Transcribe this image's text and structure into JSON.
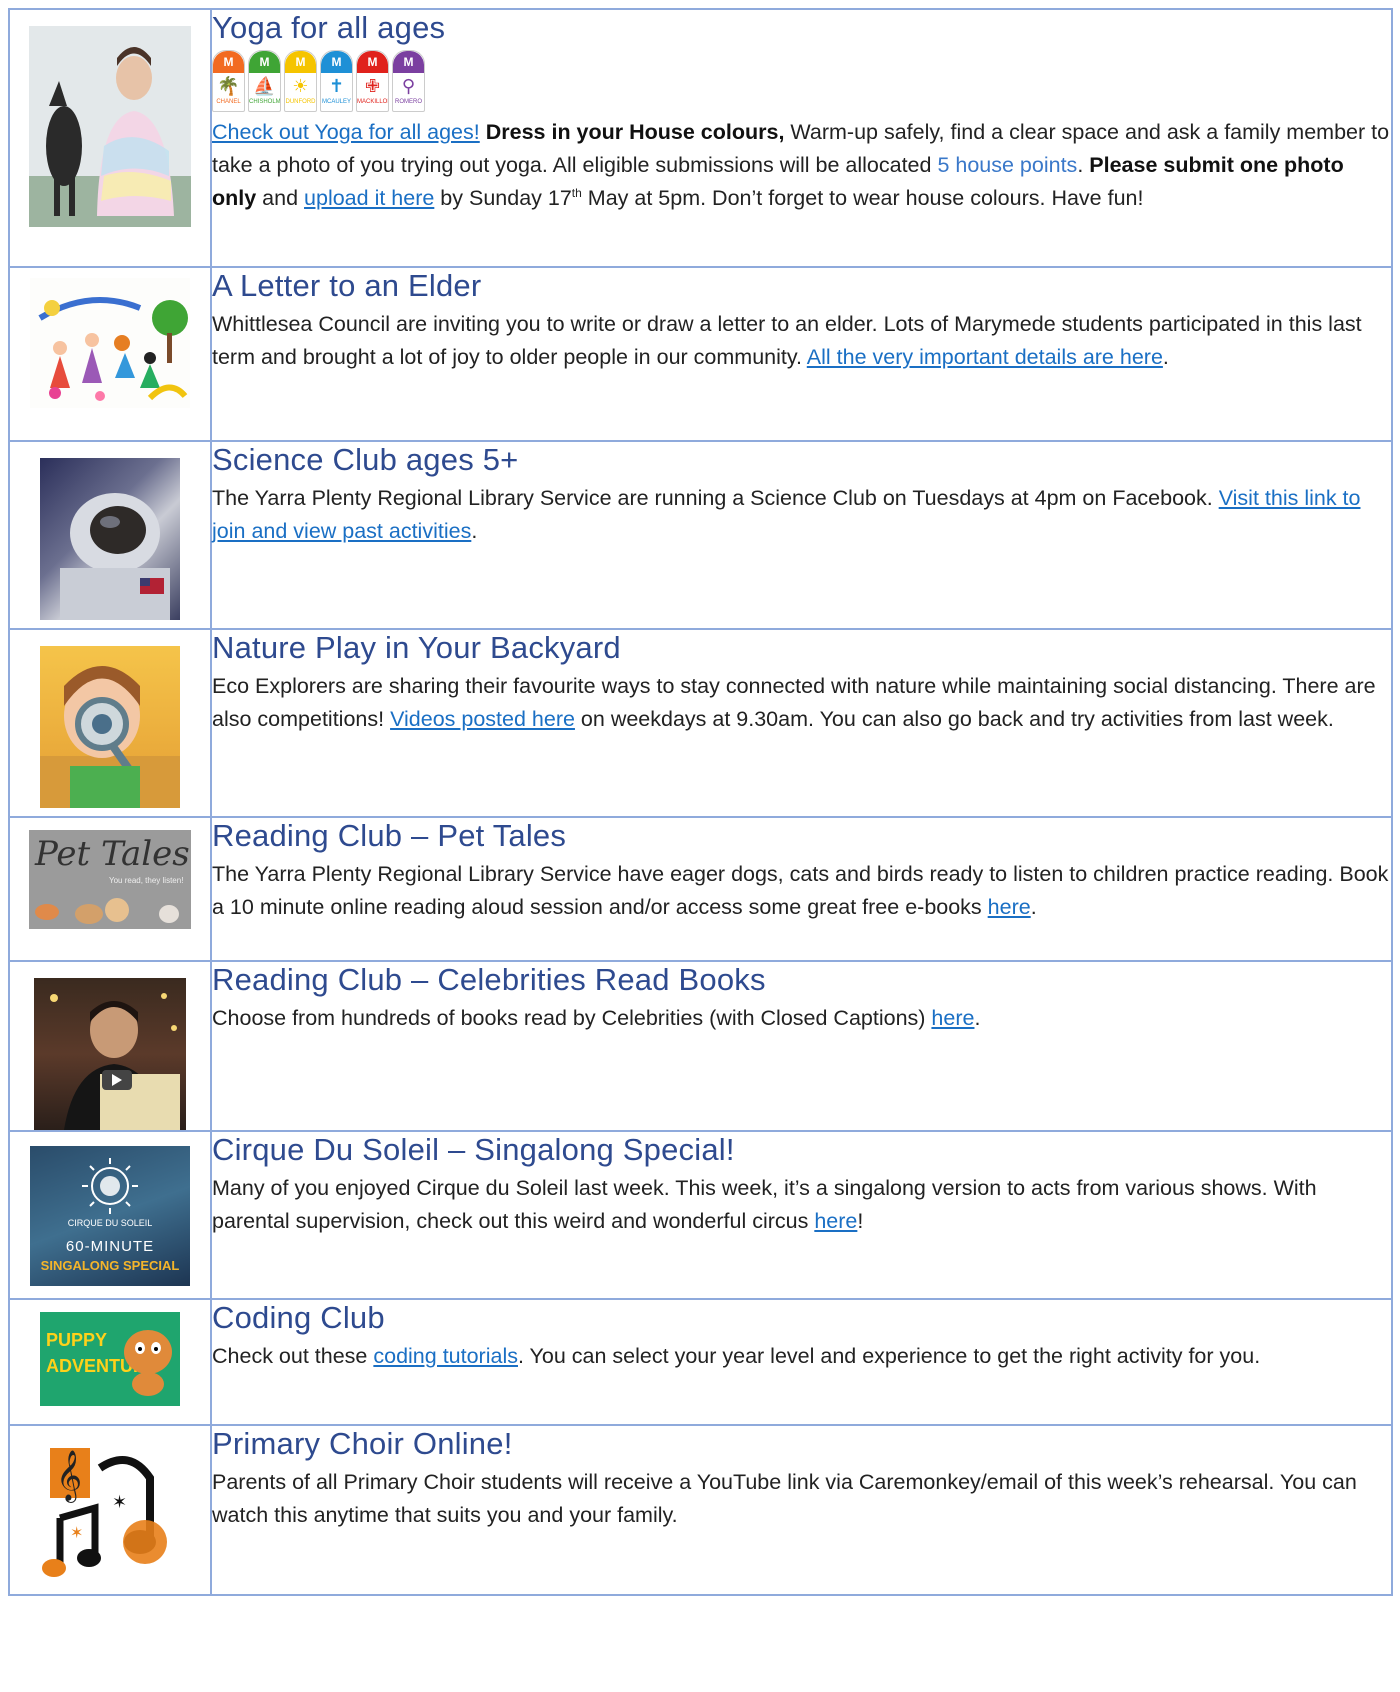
{
  "houses": [
    {
      "initial": "M",
      "color": "#f26a21",
      "symbol": "🌴",
      "name": "CHANEL"
    },
    {
      "initial": "M",
      "color": "#3fa535",
      "symbol": "⛵",
      "name": "CHISHOLM"
    },
    {
      "initial": "M",
      "color": "#f5c400",
      "symbol": "☀",
      "name": "DUNFORD"
    },
    {
      "initial": "M",
      "color": "#1e90d6",
      "symbol": "✝",
      "name": "MCAULEY"
    },
    {
      "initial": "M",
      "color": "#e0221c",
      "symbol": "✙",
      "name": "MACKILLOP"
    },
    {
      "initial": "M",
      "color": "#7b3fa0",
      "symbol": "⚲",
      "name": "ROMERO"
    }
  ],
  "rows": {
    "yoga": {
      "title": "Yoga for all ages",
      "link": "Check out Yoga for all ages!",
      "bold1": "Dress in your House colours,",
      "t1": " Warm-up safely, find a clear space and ask a family member to take a photo of you trying out yoga. All eligible submissions will be allocated ",
      "points": "5 house points",
      "t2": ". ",
      "bold2": "Please submit one photo only",
      "t3": " and ",
      "upload": "upload it here",
      "t4": " by Sunday 17",
      "sup": "th",
      "t5": " May at 5pm. Don’t forget to wear house colours. Have fun!"
    },
    "letter": {
      "title": "A Letter to an Elder",
      "t1": "Whittlesea Council are inviting you to write or draw a letter to an elder. Lots of Marymede students participated in this last term and brought a lot of joy to older people in our community. ",
      "link": "All the very important details are here",
      "t2": "."
    },
    "science": {
      "title": "Science Club ages 5+",
      "t1": "The Yarra Plenty Regional Library Service are running a Science Club on Tuesdays at 4pm on Facebook. ",
      "link": "Visit this link to join and view past activities",
      "t2": "."
    },
    "nature": {
      "title": "Nature Play in Your Backyard",
      "t1": "Eco Explorers are sharing their favourite ways to stay connected with nature while maintaining social distancing. There are also competitions! ",
      "link": "Videos posted here",
      "t2": " on weekdays at 9.30am. You can also go back and try activities from last week."
    },
    "pettales": {
      "title": "Reading Club – Pet Tales",
      "t1": "The Yarra Plenty Regional Library Service have eager dogs, cats and birds ready to listen to children practice reading. Book a 10 minute online reading aloud session and/or access some great free e-books ",
      "link": "here",
      "t2": ".",
      "img_title": "Pet Tales",
      "img_sub": "You read, they listen!"
    },
    "celeb": {
      "title": "Reading Club – Celebrities Read Books",
      "t1": "Choose from hundreds of books read by Celebrities (with Closed Captions) ",
      "link": "here",
      "t2": "."
    },
    "cirque": {
      "title": "Cirque Du Soleil – Singalong Special!",
      "t1": "Many of you enjoyed Cirque du Soleil last week. This week, it’s a singalong version to acts from various shows. With parental supervision, check out this weird and wonderful circus ",
      "link": "here",
      "t2": "!",
      "img_brand": "CIRQUE DU SOLEIL",
      "img_line1": "60-MINUTE",
      "img_line2": "SINGALONG SPECIAL"
    },
    "coding": {
      "title": "Coding Club",
      "t1": "Check out these ",
      "link": "coding tutorials",
      "t2": ". You can select your year level and experience to get the right activity for you.",
      "img_line1": "PUPPY",
      "img_line2": "ADVENTURE"
    },
    "choir": {
      "title": "Primary Choir Online!",
      "t1": "Parents of all Primary Choir students will receive a YouTube link via Caremonkey/email of this week’s rehearsal. You can watch this anytime that suits you and your family."
    }
  }
}
